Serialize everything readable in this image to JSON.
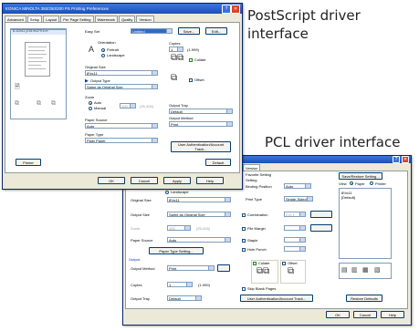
{
  "captions": {
    "postscript": "PostScript driver interface",
    "pcl": "PCL driver interface"
  },
  "ps": {
    "title": "KONICA MINOLTA 350/250/200 PS Printing Preferences",
    "tabs": [
      "Advanced",
      "Setup",
      "Layout",
      "Per Page Setting",
      "Watermark",
      "Quality",
      "Version"
    ],
    "preview_header": "8-1/2x11 [215.9x279.4 m",
    "easy_set_label": "Easy Set",
    "easy_set_value": "Untitled",
    "save_label": "Save...",
    "edit_label": "Edit...",
    "orientation_label": "Orientation",
    "portrait_label": "Portrait",
    "landscape_label": "Landscape",
    "copies_label": "Copies",
    "copies_value": "1",
    "copies_range": "(1-999)",
    "collate_label": "Collate",
    "offset_label": "Offset",
    "original_size_label": "Original Size",
    "original_size_value": "8½x11",
    "output_type_label": "Output Type",
    "output_type_value": "Same as Original Size",
    "zoom_label": "Zoom",
    "auto_label": "Auto",
    "manual_label": "Manual",
    "zoom_value": "100",
    "zoom_range": "(25-400)",
    "output_tray_label": "Output Tray",
    "output_tray_value": "Default",
    "output_method_label": "Output Method",
    "output_method_value": "Print",
    "paper_source_label": "Paper Source",
    "paper_source_value": "Auto",
    "paper_type_label": "Paper Type",
    "paper_type_value": "Plain Paper",
    "user_auth_label": "User Authentication/Account Track...",
    "default_label": "Default",
    "printer_label": "Printer",
    "ok_label": "OK",
    "cancel_label": "Cancel",
    "apply_label": "Apply",
    "help_label": "Help"
  },
  "pcl": {
    "tabs": [
      "Version"
    ],
    "favorite_setting_label": "Favorite Setting",
    "save_restore_label": "Save/Restore Setting...",
    "setting_label": "Setting",
    "binding_position_label": "Binding Position",
    "binding_position_value": "Auto",
    "landscape_label": "Landscape",
    "print_type_label": "Print Type",
    "print_type_value": "Single-Sided",
    "original_size_label": "Original Size",
    "original_size_value": "8½x11",
    "combination_label": "Combination",
    "combination_value": "2 in 1",
    "output_size_label": "Output Size",
    "output_size_value": "Same as Original Size",
    "file_margin_label": "File Margin",
    "zoom_label": "Zoom",
    "zoom_value": "100",
    "zoom_range": "(25-400)",
    "staple_label": "Staple",
    "paper_source_label": "Paper Source",
    "paper_source_value": "Auto",
    "hole_punch_label": "Hole Punch",
    "paper_type_setting_label": "Paper Type Setting...",
    "output_label": "Output",
    "output_method_label": "Output Method",
    "output_method_value": "Print",
    "collate_label": "Collate",
    "offset_label": "Offset",
    "copies_label": "Copies",
    "copies_value": "1",
    "copies_range": "(1-999)",
    "output_tray_label": "Output Tray",
    "output_tray_value": "Default",
    "skip_blank_label": "Skip Blank Pages",
    "user_auth_label": "User Authentication/Account Track...",
    "view_label": "View",
    "paper_label": "Paper",
    "printer_label": "Printer",
    "preview_text_1": "8½x11",
    "preview_text_2": "[Default]",
    "restore_defaults_label": "Restore Defaults",
    "ok_label": "OK",
    "cancel_label": "Cancel",
    "help_label": "Help"
  }
}
